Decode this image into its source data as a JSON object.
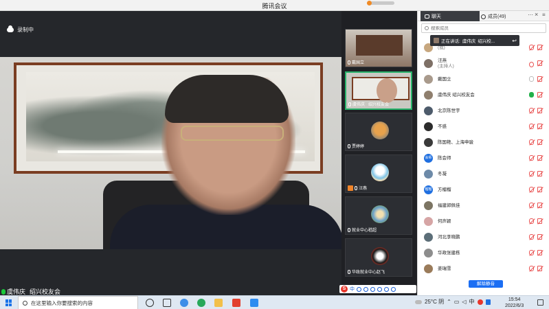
{
  "window": {
    "title": "腾讯会议"
  },
  "recording": {
    "label": "录制中"
  },
  "main_video": {
    "speaker_name": "虞伟庆",
    "speaker_org": "绍兴校友会"
  },
  "thumbnails": [
    {
      "name": "戴国立",
      "active": false
    },
    {
      "name": "虞伟庆",
      "org": "绍兴校友会",
      "active": true
    },
    {
      "name": "贾婷婷",
      "active": false
    },
    {
      "name": "汪燕",
      "active": false
    },
    {
      "name": "就业中心嵇超",
      "active": false
    },
    {
      "name": "华政就业中心赵飞",
      "active": false
    }
  ],
  "ime_bar": {
    "logo": "S",
    "mode": "中"
  },
  "panel": {
    "tabs": {
      "chat": "聊天",
      "members": "成员(49)"
    },
    "more": "···",
    "close": "×",
    "search_placeholder": "搜索成员",
    "speaking": {
      "prefix": "正在讲话:",
      "name": "虞伟庆",
      "org": "绍兴校..."
    },
    "members": [
      {
        "name": "",
        "sub": "(我)",
        "color": "#c7a77f",
        "text": "",
        "mic": "off",
        "cam": "off"
      },
      {
        "name": "汪燕",
        "sub": "(主持人)",
        "color": "#7e7066",
        "text": "",
        "mic": "eye",
        "cam": "off"
      },
      {
        "name": "戴国立",
        "sub": "",
        "color": "#a99a8c",
        "text": "",
        "mic": "grey",
        "cam": "off"
      },
      {
        "name": "虞伟庆  绍兴校友会",
        "sub": "",
        "color": "#8f7f6e",
        "text": "",
        "mic": "green",
        "cam": "off"
      },
      {
        "name": "北京陈世宇",
        "sub": "",
        "color": "#4d5b6b",
        "text": "",
        "mic": "off",
        "cam": "off"
      },
      {
        "name": "不惑",
        "sub": "",
        "color": "#2c2c2c",
        "text": "",
        "mic": "off",
        "cam": "off"
      },
      {
        "name": "陈国艳、上海申骏",
        "sub": "",
        "color": "#3a3a3a",
        "text": "",
        "mic": "off",
        "cam": "off"
      },
      {
        "name": "陈会师",
        "sub": "",
        "color": "#1f6fe0",
        "text": "会师",
        "mic": "off",
        "cam": "off"
      },
      {
        "name": "冬凝",
        "sub": "",
        "color": "#6d8aa8",
        "text": "",
        "mic": "off",
        "cam": "off"
      },
      {
        "name": "方榴榴",
        "sub": "",
        "color": "#1f6fe0",
        "text": "榴榴",
        "mic": "off",
        "cam": "off"
      },
      {
        "name": "福建郭佩佳",
        "sub": "",
        "color": "#7c7563",
        "text": "",
        "mic": "off",
        "cam": "off"
      },
      {
        "name": "何声颖",
        "sub": "",
        "color": "#d6a5a5",
        "text": "",
        "mic": "off",
        "cam": "off"
      },
      {
        "name": "河北李晓鹏",
        "sub": "",
        "color": "#5c6e78",
        "text": "",
        "mic": "off",
        "cam": "off"
      },
      {
        "name": "华政张建栋",
        "sub": "",
        "color": "#8d8d8d",
        "text": "",
        "mic": "off",
        "cam": "off"
      },
      {
        "name": "姜瑞雪",
        "sub": "",
        "color": "#9a7b5a",
        "text": "",
        "mic": "off",
        "cam": "off"
      }
    ],
    "unmute_all": "解除静音"
  },
  "taskbar": {
    "search_text": "在这里输入你要搜索的内容",
    "weather": "25°C 阴",
    "ime": "中",
    "time": "15:54",
    "date": "2022/6/3"
  }
}
